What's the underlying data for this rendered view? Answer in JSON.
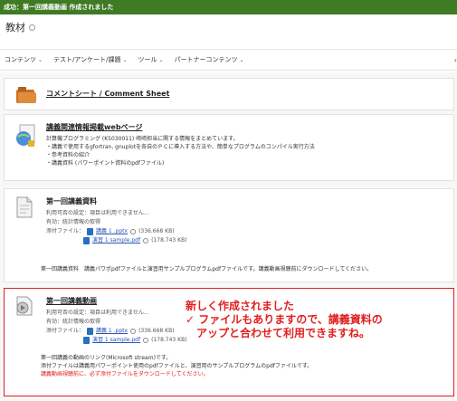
{
  "success_message": "成功：第一回講義動画 作成されました",
  "page": {
    "title": "教材"
  },
  "menu": [
    {
      "label": "コンテンツ"
    },
    {
      "label": "テスト/アンケート/課題"
    },
    {
      "label": "ツール"
    },
    {
      "label": "パートナーコンテンツ"
    }
  ],
  "items": {
    "comment": {
      "title": "コメントシート / Comment Sheet"
    },
    "webpage": {
      "title": "講義関連情報掲載webページ",
      "lines": [
        "計算機プログラミング (K5030011) 﨑﨑担当に関する情報をまとめています。",
        "・講義で使用するgfortran, gnuplotを各自のＰＣに導入する方法や、簡単なプログラムのコンパイル実行方法",
        "・参考資料の紹介",
        "・講義資料 (パワーポイント資料のpdfファイル)"
      ]
    },
    "shiryo": {
      "title": "第一回講義資料",
      "availability": "利用可否の設定：項目は利用できません...",
      "enabled": "有効：統計情報の取得",
      "attachments_label": "添付ファイル：",
      "files": [
        {
          "name": "講義 1 .pptx",
          "size": "(336.668 KB)"
        },
        {
          "name": "演習 1 sample.pdf",
          "size": "(178.743 KB)"
        }
      ],
      "description": "第一回講義資料　講義パワポpdfファイルと演習用サンプルプログラムpdfファイルです。講義動画視聴前にダウンロードしてください。"
    },
    "douga": {
      "title": "第一回講義動画",
      "availability": "利用可否の設定：項目は利用できません...",
      "enabled": "有効：統計情報の取得",
      "attachments_label": "添付ファイル：",
      "files": [
        {
          "name": "講義 1 .pptx",
          "size": "(336.668 KB)"
        },
        {
          "name": "演習 1 sample.pdf",
          "size": "(178.743 KB)"
        }
      ],
      "desc1": "第一回講義の動画のリンク(Microsoft stream)です。",
      "desc2": "添付ファイルは講義用パワーポイント使用のpdfファイルと、演習用のサンプルプログラムのpdfファイルです。",
      "desc3": "講義動画視聴前に、必ず添付ファイルをダウンロードしてください。",
      "annotation": [
        "新しく作成されました",
        "✓ ファイルもありますので、講義資料の",
        "　アップと合わせて利用できますね。"
      ]
    }
  },
  "colors": {
    "success": "#3f7a24",
    "accent_red": "#e02020",
    "link": "#2a56b8"
  }
}
